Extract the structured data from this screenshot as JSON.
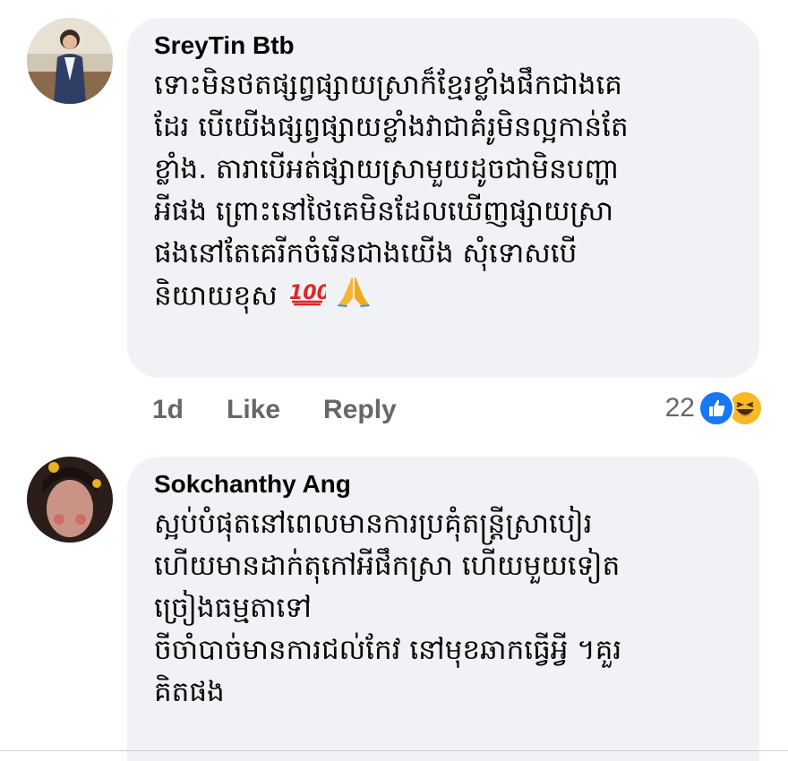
{
  "comments": [
    {
      "author": "SreyTin Btb",
      "lines": [
        "ទោះមិនថតផ្សព្វផ្សាយស្រាក៏ខ្មែរខ្លាំងផឹកជាងគេ",
        "ដែរ បើយើងផ្សព្វផ្សាយខ្លាំងវាជាគំរូមិនល្អកាន់តែ",
        "ខ្លាំង. តារាបើអត់ផ្សាយស្រាមួយដូចជាមិនបញ្ហា",
        "អីផង ព្រោះនៅថៃគេមិនដែលឃើញផ្សាយស្រា",
        "ផងនៅតែគេរីកចំរើនជាងយើង សុំទោសបើ",
        "និយាយខុស"
      ],
      "emojis": [
        "hundred-points-icon",
        "folded-hands-icon"
      ],
      "time": "1d",
      "like_label": "Like",
      "reply_label": "Reply",
      "reaction_count": "22",
      "reaction_icons": [
        "like-reaction-icon",
        "haha-reaction-icon"
      ]
    },
    {
      "author": "Sokchanthy Ang",
      "lines": [
        "ស្អប់បំផុតនៅពេលមានការប្រគុំតន្ត្រីស្រាបៀរ",
        "ហើយមានដាក់តុកៅអីផឹកស្រា ហើយមួយទៀត",
        "ច្រៀងធម្មតាទៅ",
        "ចីចាំបាច់មានការជល់កែវ  នៅមុខឆាកធ្វើអ្វី ។គួរ",
        "គិតផង"
      ]
    }
  ],
  "colors": {
    "bubble": "#f0f2f5",
    "text": "#050505",
    "meta": "#65676b",
    "like_blue": "#1877f2",
    "haha_yellow": "#f7b928"
  }
}
